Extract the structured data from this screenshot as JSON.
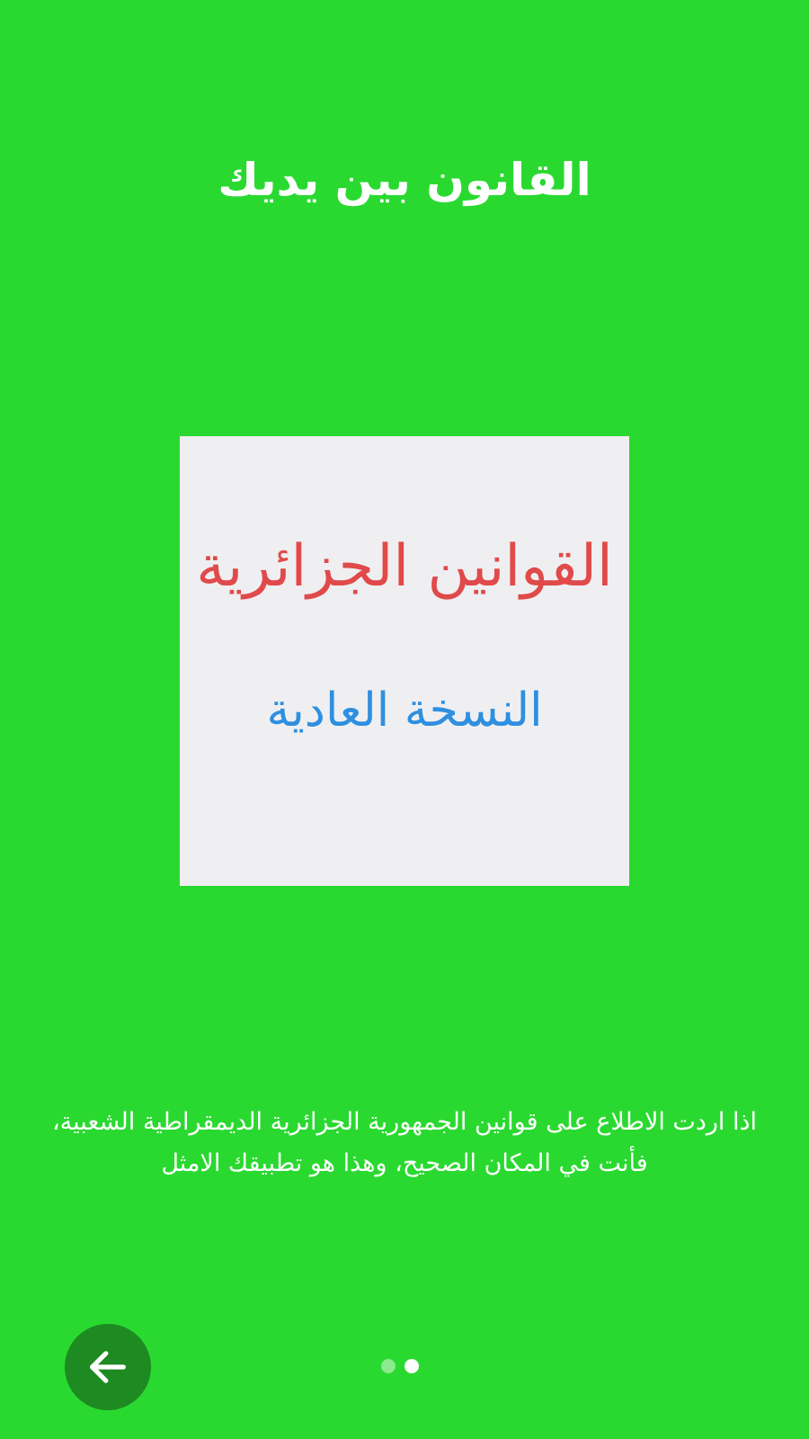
{
  "slide": {
    "title": "القانون بين يديك",
    "logo_line1": "القوانين الجزائرية",
    "logo_line2": "النسخة العادية",
    "description_line1": "اذا اردت الاطلاع على قوانين الجمهورية الجزائرية الديمقراطية الشعبية،",
    "description_line2": "فأنت في المكان الصحيح، وهذا هو تطبيقك الامثل"
  },
  "pager": {
    "total": 2,
    "current": 2
  },
  "nav": {
    "back_icon": "arrow-left-icon"
  },
  "colors": {
    "background": "#2ad930",
    "button": "#1e8a22",
    "logo_red": "#e04a4a",
    "logo_blue": "#2f8fe0"
  }
}
